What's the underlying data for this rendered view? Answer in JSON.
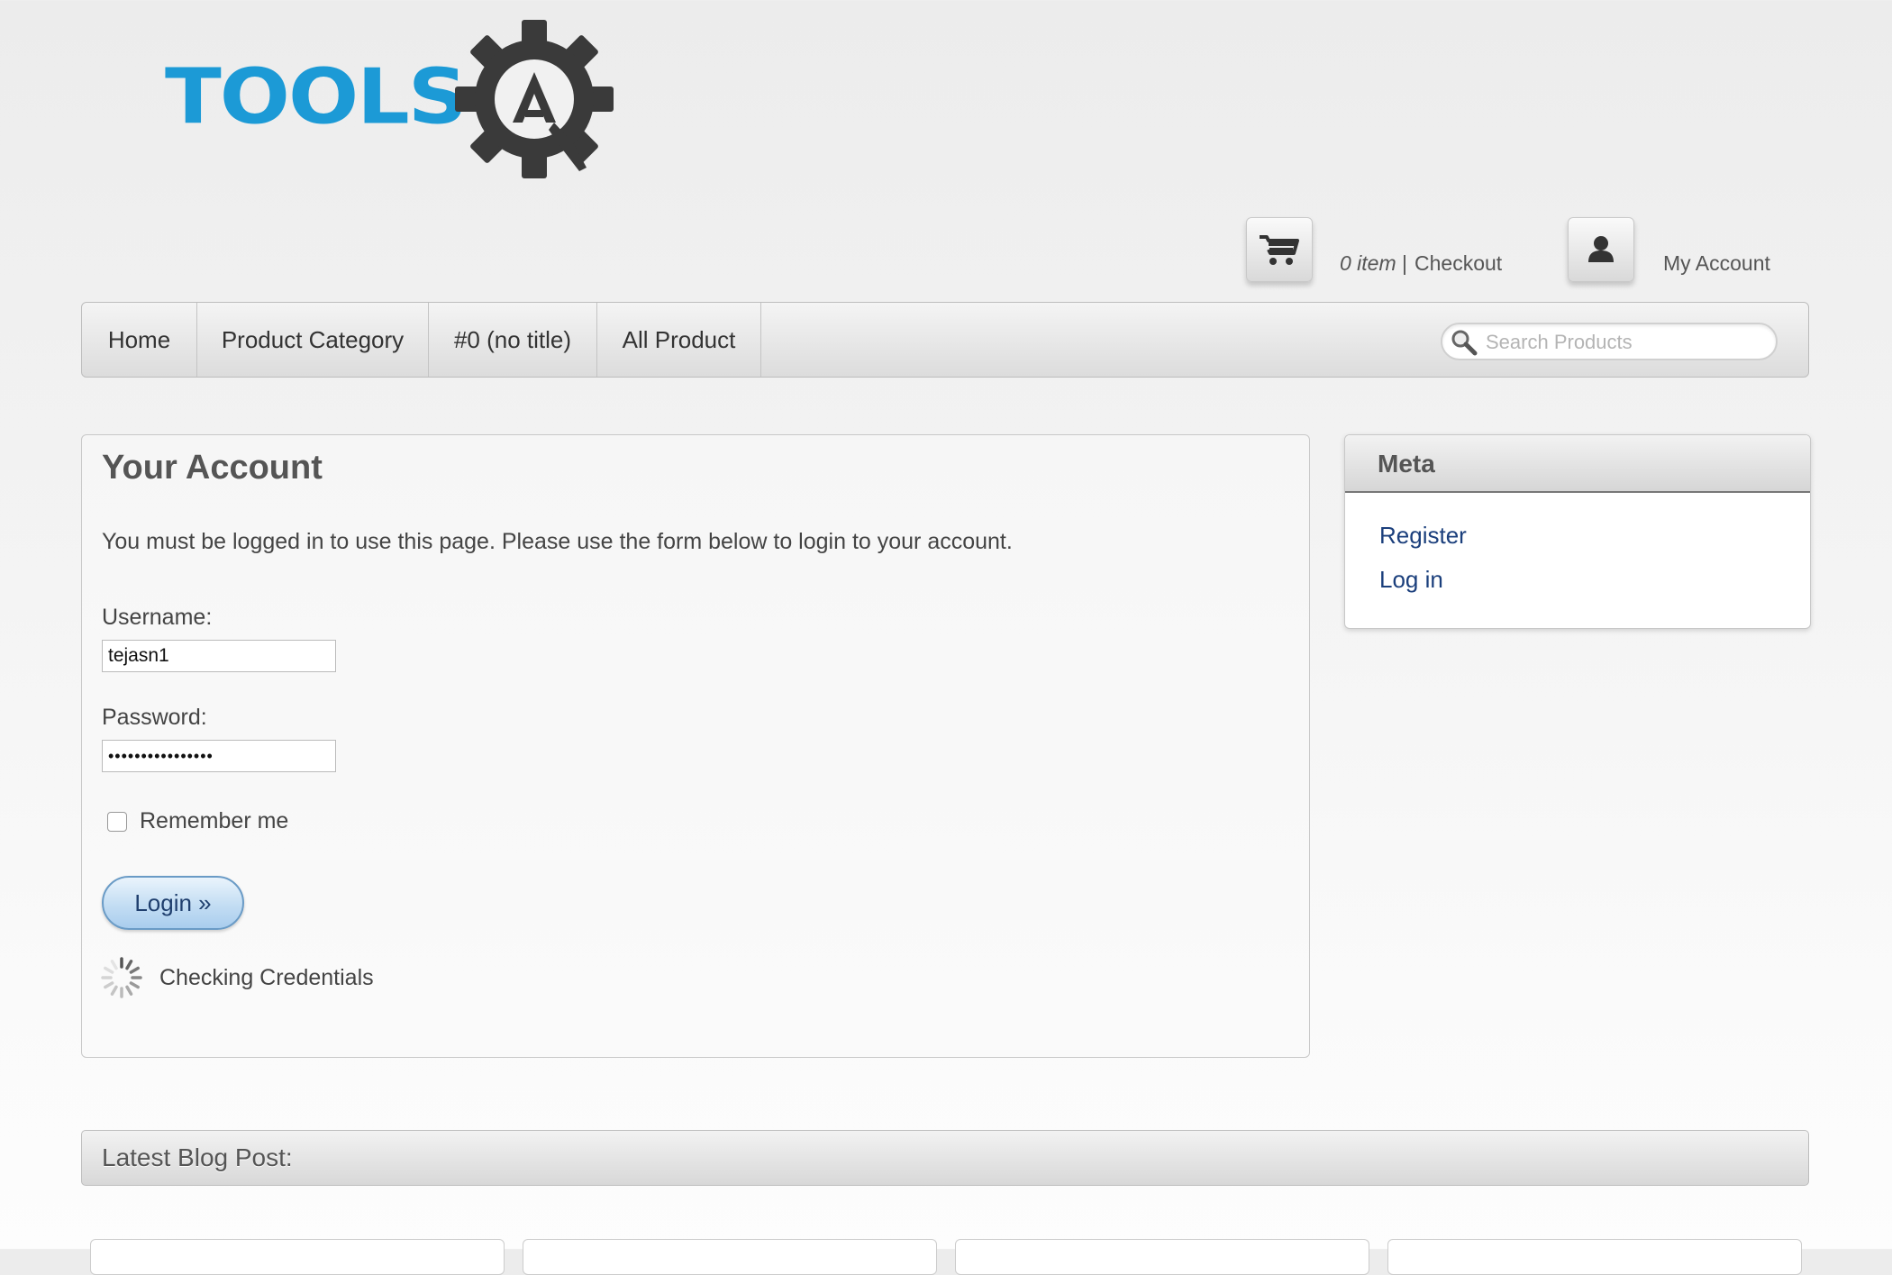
{
  "logo": {
    "text": "TOOLS",
    "letter": "QA"
  },
  "header": {
    "cart_count": "0 item",
    "cart_separator": "|",
    "checkout_label": "Checkout",
    "my_account_label": "My Account"
  },
  "nav": {
    "items": [
      {
        "label": "Home"
      },
      {
        "label": "Product Category"
      },
      {
        "label": "#0 (no title)"
      },
      {
        "label": "All Product"
      }
    ],
    "search_placeholder": "Search Products"
  },
  "account": {
    "title": "Your Account",
    "intro": "You must be logged in to use this page. Please use the form below to login to your account.",
    "username_label": "Username:",
    "username_value": "tejasn1",
    "password_label": "Password:",
    "password_value": "****************",
    "remember_label": "Remember me",
    "remember_checked": false,
    "login_button": "Login »",
    "status_text": "Checking Credentials"
  },
  "meta": {
    "title": "Meta",
    "links": [
      {
        "label": "Register"
      },
      {
        "label": "Log in"
      }
    ]
  },
  "blog": {
    "title": "Latest Blog Post:"
  },
  "colors": {
    "brand_blue": "#1c9ad6",
    "gear_dark": "#3a3a3a",
    "link_blue": "#1b3f7c",
    "button_blue": "#c3ddf3"
  }
}
